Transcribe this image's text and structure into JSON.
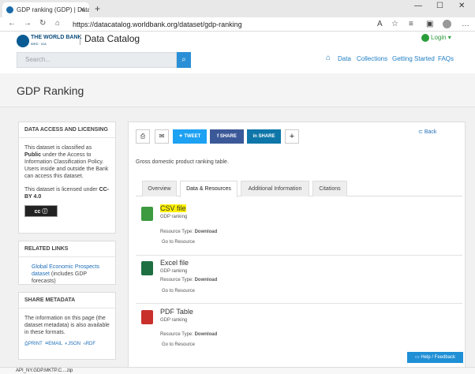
{
  "browser": {
    "tab_title": "GDP ranking (GDP) | Data Catalo",
    "url": "https://datacatalog.worldbank.org/dataset/gdp-ranking",
    "new_tab": "+",
    "minimize": "—",
    "maximize": "☐",
    "close": "✕"
  },
  "header": {
    "logo_text_line1": "THE WORLD BANK",
    "logo_text_line2": "IBRD · IDA",
    "catalog_title": "Data Catalog",
    "login": "Login ▾",
    "search_placeholder": "Search...",
    "nav": [
      "Data",
      "Collections",
      "Getting Started",
      "FAQs"
    ]
  },
  "page": {
    "title": "GDP Ranking"
  },
  "sidebar": {
    "access_title": "DATA ACCESS AND LICENSING",
    "access_text_1": "This dataset is classified as",
    "access_public": "Public",
    "access_text_2": "under the Access to Information Classification Policy. Users inside and outside the Bank can access this dataset.",
    "license_text": "This dataset is licensed under",
    "license_link": "CC-BY 4.0",
    "cc_badge": "cc ⓘ",
    "related_title": "RELATED LINKS",
    "related_link": "Global Economic Prospects dataset",
    "related_suffix": "(includes GDP forecasts)",
    "share_title": "SHARE METADATA",
    "share_text": "The information on this page (the dataset metadata) is also available in these formats.",
    "formats": [
      "PRINT",
      "EMAIL",
      "JSON",
      "RDF"
    ]
  },
  "share_buttons": {
    "tweet": "TWEET",
    "share_fb": "SHARE",
    "share_in": "SHARE",
    "plus": "+"
  },
  "back": "Back",
  "description": "Gross domestic product ranking table.",
  "tabs": [
    "Overview",
    "Data & Resources",
    "Additional Information",
    "Citations"
  ],
  "resources": [
    {
      "title": "CSV file",
      "subtitle": "GDP ranking",
      "type_label": "Resource Type:",
      "type": "Download",
      "link": "Go to Resource",
      "color": "#3c9a3f"
    },
    {
      "title": "Excel file",
      "subtitle": "GDP ranking",
      "type_label": "Resource Type:",
      "type": "Download",
      "link": "Go to Resource",
      "color": "#1d6f42"
    },
    {
      "title": "PDF Table",
      "subtitle": "GDP ranking",
      "type_label": "Resource Type:",
      "type": "Download",
      "link": "Go to Resource",
      "color": "#c9302c"
    }
  ],
  "help": "Help / Feedback",
  "download_bar": "API_NY.GDP.MKTP.C....zip"
}
